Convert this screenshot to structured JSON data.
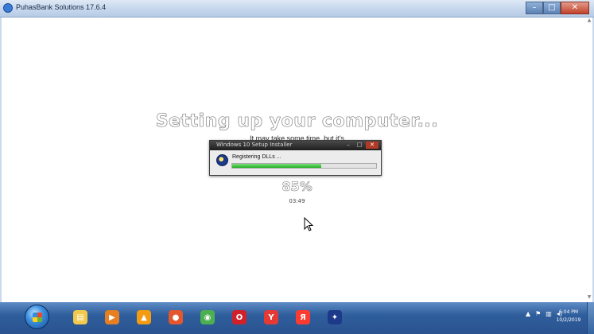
{
  "window": {
    "title": "PuhasBank Solutions 17.6.4",
    "minimize": "–",
    "maximize": "□",
    "close": "✕"
  },
  "setup_screen": {
    "heading": "Setting up your computer...",
    "subtitle": "It may take some time, but it's",
    "percent": "85%",
    "small_text": "03:49"
  },
  "progress_dialog": {
    "title": "Windows 10 Setup Installer",
    "status": "Registering DLLs ...",
    "progress": 0.62,
    "minimize": "–",
    "maximize": "□",
    "close": "✕"
  },
  "taskbar": {
    "apps": [
      {
        "icon": "explorer-icon",
        "glyph": "▤",
        "color": "#f2c94c"
      },
      {
        "icon": "media-player-icon",
        "glyph": "▶",
        "color": "#e67e22"
      },
      {
        "icon": "vlc-icon",
        "glyph": "▲",
        "color": "#f39c12"
      },
      {
        "icon": "firefox-icon",
        "glyph": "●",
        "color": "#e4572e"
      },
      {
        "icon": "chrome-icon",
        "glyph": "◉",
        "color": "#4caf50"
      },
      {
        "icon": "opera-icon",
        "glyph": "O",
        "color": "#d1202a"
      },
      {
        "icon": "yandex-icon",
        "glyph": "Y",
        "color": "#e53935"
      },
      {
        "icon": "yandex-browser-icon",
        "glyph": "Я",
        "color": "#ff3b30"
      },
      {
        "icon": "setup-app-icon",
        "glyph": "✦",
        "color": "#1d3a8a"
      }
    ],
    "tray_expand": "▲",
    "tray_flag": "⚑",
    "tray_network": "▥",
    "tray_volume": "◂)",
    "clock_time": "6:04 PM",
    "clock_date": "10/2/2019"
  }
}
